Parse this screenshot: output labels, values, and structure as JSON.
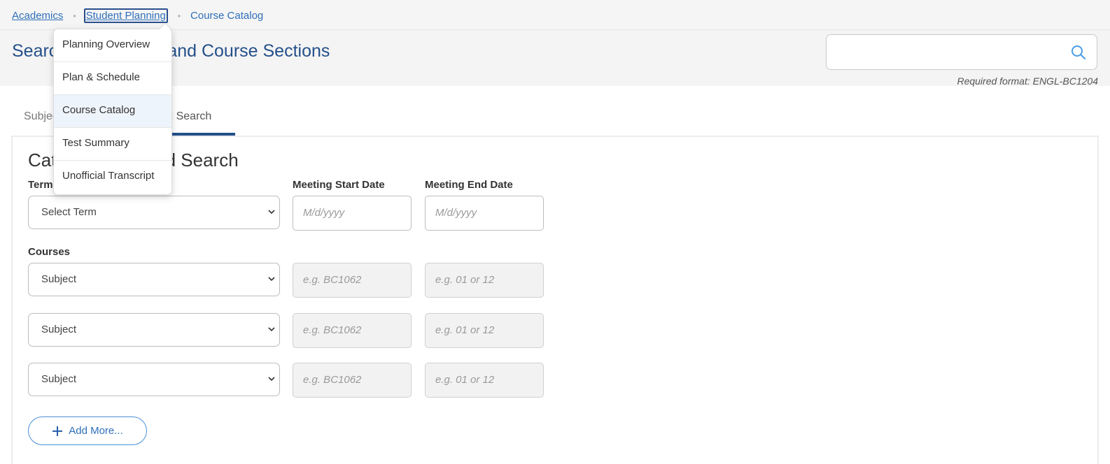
{
  "breadcrumb": {
    "items": [
      {
        "label": "Academics"
      },
      {
        "label": "Student Planning"
      },
      {
        "label": "Course Catalog"
      }
    ],
    "separator": "•"
  },
  "header": {
    "title": "Search for Courses and Course Sections",
    "search": {
      "value": "",
      "placeholder": "",
      "hint": "Required format: ENGL-BC1204"
    }
  },
  "dropdown_menu": {
    "items": [
      {
        "label": "Planning Overview"
      },
      {
        "label": "Plan & Schedule"
      },
      {
        "label": "Course Catalog",
        "active": true
      },
      {
        "label": "Test Summary"
      },
      {
        "label": "Unofficial Transcript"
      }
    ]
  },
  "tabs": [
    {
      "label": "Subjects"
    },
    {
      "label": "Advanced Search",
      "active": true
    }
  ],
  "panel": {
    "title": "Catalog Advanced Search",
    "term_label": "Term",
    "term_value": "Select Term",
    "start_date_label": "Meeting Start Date",
    "start_date_placeholder": "M/d/yyyy",
    "end_date_label": "Meeting End Date",
    "end_date_placeholder": "M/d/yyyy",
    "courses_label": "Courses",
    "course_rows": [
      {
        "subject": "Subject",
        "course_placeholder": "e.g. BC1062",
        "section_placeholder": "e.g. 01 or 12"
      },
      {
        "subject": "Subject",
        "course_placeholder": "e.g. BC1062",
        "section_placeholder": "e.g. 01 or 12"
      },
      {
        "subject": "Subject",
        "course_placeholder": "e.g. BC1062",
        "section_placeholder": "e.g. 01 or 12"
      }
    ],
    "add_more_label": "Add More..."
  },
  "colors": {
    "accent": "#24508a",
    "link": "#2f6fb8",
    "button_border": "#4a90d9"
  }
}
